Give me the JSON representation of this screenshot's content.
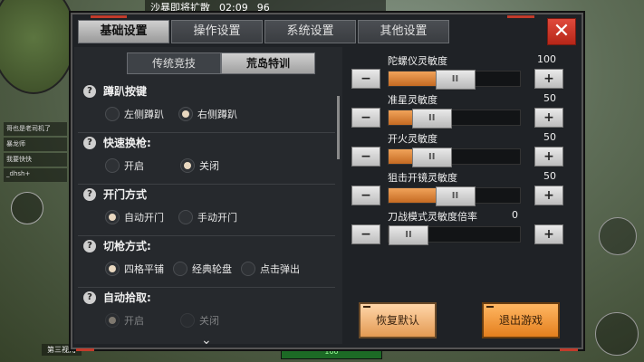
{
  "hud": {
    "top_info": "沙暴即将扩散",
    "timer": "02:09",
    "alive_count": "96",
    "bottom_left_label": "第三视角",
    "health_value": "100",
    "team": [
      "哥也是老司机了",
      "暴龙师",
      "我要快快",
      "_dhsh+"
    ]
  },
  "tabs": [
    "基础设置",
    "操作设置",
    "系统设置",
    "其他设置"
  ],
  "active_tab": 0,
  "subtabs": [
    "传统竞技",
    "荒岛特训"
  ],
  "active_subtab": 1,
  "settings": [
    {
      "title": "蹲趴按键",
      "options": [
        "左侧蹲趴",
        "右侧蹲趴"
      ],
      "selected": 1
    },
    {
      "title": "快速换枪:",
      "options": [
        "开启",
        "关闭"
      ],
      "selected": 1
    },
    {
      "title": "开门方式",
      "options": [
        "自动开门",
        "手动开门"
      ],
      "selected": 0
    },
    {
      "title": "切枪方式:",
      "options": [
        "四格平铺",
        "经典轮盘",
        "点击弹出"
      ],
      "selected": 0
    },
    {
      "title": "自动拾取:",
      "options": [
        "开启",
        "关闭"
      ],
      "selected": 0
    }
  ],
  "sliders": [
    {
      "label": "陀螺仪灵敏度",
      "value": "100",
      "fill": 0.5
    },
    {
      "label": "准星灵敏度",
      "value": "50",
      "fill": 0.25
    },
    {
      "label": "开火灵敏度",
      "value": "50",
      "fill": 0.25
    },
    {
      "label": "狙击开镜灵敏度",
      "value": "50",
      "fill": 0.5
    },
    {
      "label": "刀战模式灵敏度倍率",
      "value": "0",
      "fill": 0.0
    }
  ],
  "buttons": {
    "minus": "−",
    "plus": "+",
    "thumb": "II",
    "reset": "恢复默认",
    "exit": "退出游戏",
    "close": "✕"
  },
  "colors": {
    "accent_orange": "#e47f1d",
    "close_red": "#d23a2b",
    "panel_bg": "#1f2226"
  }
}
